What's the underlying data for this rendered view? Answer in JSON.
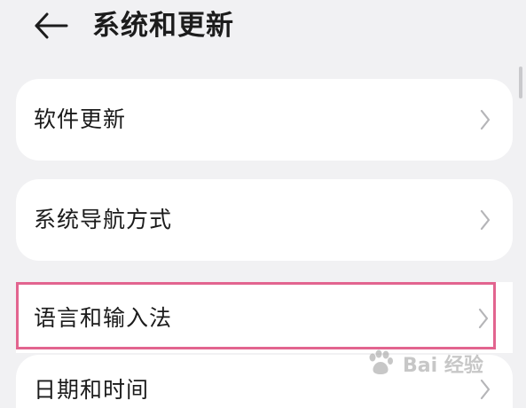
{
  "header": {
    "title": "系统和更新",
    "back_icon": "arrow-left-icon"
  },
  "settings_items": [
    {
      "label": "软件更新",
      "icon": "chevron-right-icon"
    },
    {
      "label": "系统导航方式",
      "icon": "chevron-right-icon"
    },
    {
      "label": "语言和输入法",
      "icon": "chevron-right-icon",
      "highlighted": true
    },
    {
      "label": "日期和时间",
      "icon": "chevron-right-icon"
    }
  ],
  "watermark": {
    "text": "Bai 经验",
    "brand": "Baidu"
  },
  "colors": {
    "background": "#f1f1f3",
    "card": "#ffffff",
    "highlight": "#e2648f",
    "chevron": "#b5b5b8",
    "text": "#1b1b1b"
  }
}
